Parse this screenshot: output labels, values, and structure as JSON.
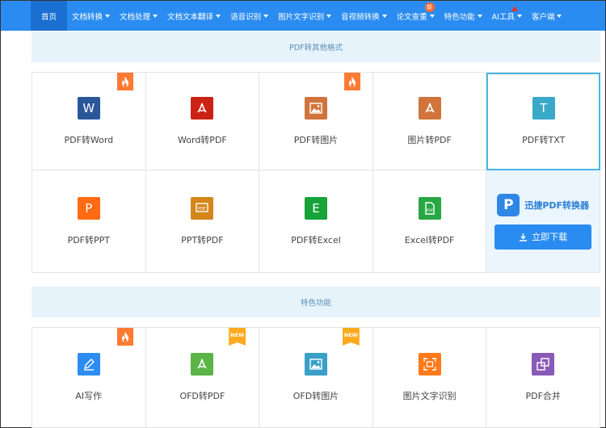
{
  "nav": {
    "items": [
      {
        "label": "首页",
        "caret": false
      },
      {
        "label": "文档转换",
        "caret": true
      },
      {
        "label": "文档处理",
        "caret": true
      },
      {
        "label": "文档文本翻译",
        "caret": true
      },
      {
        "label": "语音识别",
        "caret": true
      },
      {
        "label": "图片文字识别",
        "caret": true
      },
      {
        "label": "音视频转换",
        "caret": true
      },
      {
        "label": "论文查重",
        "caret": true,
        "badge": "新"
      },
      {
        "label": "特色功能",
        "caret": true
      },
      {
        "label": "AI工具",
        "caret": true,
        "hot": true
      },
      {
        "label": "客户端",
        "caret": true
      }
    ]
  },
  "section1": {
    "title": "PDF转其他格式",
    "cards": [
      {
        "label": "PDF转Word",
        "icon": "word-icon",
        "glyph": "W",
        "color": "#2b579a",
        "tag": "flame"
      },
      {
        "label": "Word转PDF",
        "icon": "pdf-icon",
        "glyph": "",
        "color": "#cc2214",
        "tag": ""
      },
      {
        "label": "PDF转图片",
        "icon": "image-icon",
        "glyph": "",
        "color": "#d0743c",
        "tag": "flame"
      },
      {
        "label": "图片转PDF",
        "icon": "pdf-icon",
        "glyph": "",
        "color": "#d0743c",
        "tag": ""
      },
      {
        "label": "PDF转TXT",
        "icon": "text-icon",
        "glyph": "T",
        "color": "#3aa8c7",
        "tag": ""
      },
      {
        "label": "PDF转PPT",
        "icon": "ppt-icon",
        "glyph": "P",
        "color": "#ff6a13",
        "tag": ""
      },
      {
        "label": "PPT转PDF",
        "icon": "ppt-pdf-icon",
        "glyph": "",
        "color": "#d4861b",
        "tag": ""
      },
      {
        "label": "PDF转Excel",
        "icon": "excel-icon",
        "glyph": "E",
        "color": "#17a33a",
        "tag": ""
      },
      {
        "label": "Excel转PDF",
        "icon": "excel-pdf-icon",
        "glyph": "",
        "color": "#28a745",
        "tag": ""
      }
    ],
    "promo": {
      "brand": "迅捷PDF转换器",
      "logo": "P",
      "button": "立即下载"
    }
  },
  "section2": {
    "title": "特色功能",
    "cards": [
      {
        "label": "AI写作",
        "icon": "pen-icon",
        "glyph": "",
        "color": "#2d8cf0",
        "tag": "flame"
      },
      {
        "label": "OFD转PDF",
        "icon": "ofd-icon",
        "glyph": "",
        "color": "#5ab446",
        "tag": "NEW"
      },
      {
        "label": "OFD转图片",
        "icon": "ofd-image-icon",
        "glyph": "",
        "color": "#3aa0c8",
        "tag": "NEW"
      },
      {
        "label": "图片文字识别",
        "icon": "scan-icon",
        "glyph": "",
        "color": "#ff7a1a",
        "tag": ""
      },
      {
        "label": "PDF合并",
        "icon": "merge-icon",
        "glyph": "",
        "color": "#8a5ab8",
        "tag": ""
      }
    ]
  }
}
